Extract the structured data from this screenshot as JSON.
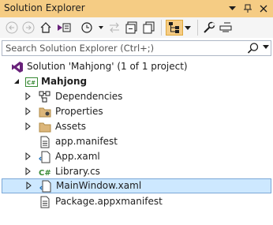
{
  "window": {
    "title": "Solution Explorer"
  },
  "titlebar_buttons": [
    {
      "name": "dropdown-icon",
      "glyph": "▾"
    },
    {
      "name": "pin-icon",
      "glyph": "⊟"
    },
    {
      "name": "close-icon",
      "glyph": "✕"
    }
  ],
  "search": {
    "placeholder": "Search Solution Explorer (Ctrl+;)"
  },
  "tree": {
    "solution": "Solution 'Mahjong' (1 of 1 project)",
    "project": "Mahjong",
    "items": [
      {
        "label": "Dependencies",
        "icon": "dependencies-icon"
      },
      {
        "label": "Properties",
        "icon": "properties-folder-icon"
      },
      {
        "label": "Assets",
        "icon": "folder-icon"
      },
      {
        "label": "app.manifest",
        "icon": "manifest-file-icon"
      },
      {
        "label": "App.xaml",
        "icon": "xaml-file-icon"
      },
      {
        "label": "Library.cs",
        "icon": "csharp-file-icon"
      },
      {
        "label": "MainWindow.xaml",
        "icon": "xaml-file-icon"
      },
      {
        "label": "Package.appxmanifest",
        "icon": "manifest-file-icon"
      }
    ]
  },
  "colors": {
    "titlebar": "#f5cc84",
    "selection": "#cde8ff",
    "accent": "#68217a"
  }
}
